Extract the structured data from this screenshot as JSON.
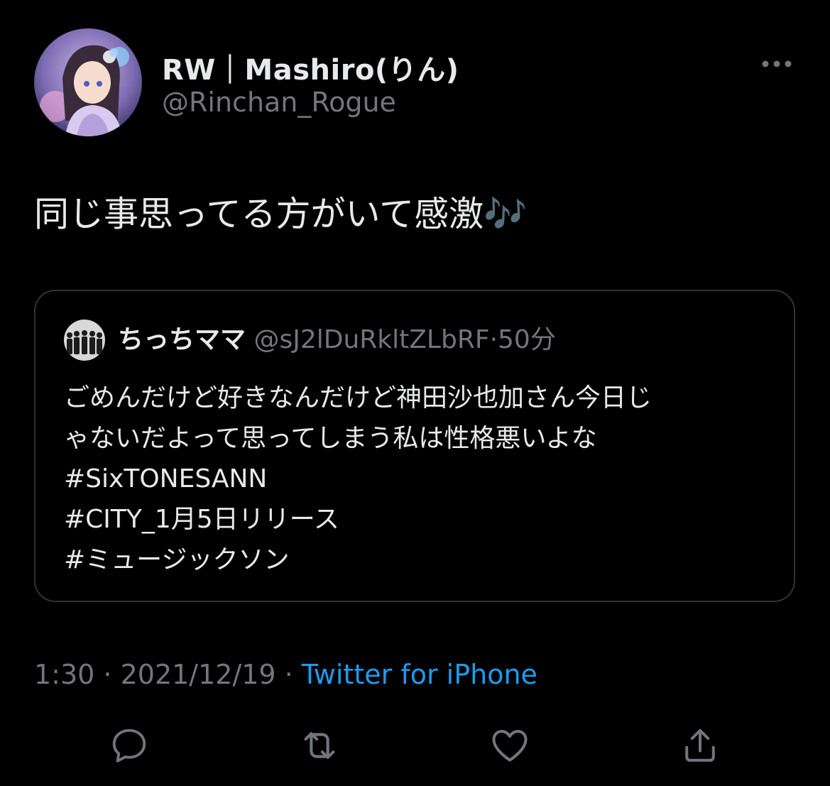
{
  "tweet": {
    "author": {
      "display_name": "RW｜Mashiro(りん)",
      "handle": "@Rinchan_Rogue",
      "avatar_icon": "anime-avatar-icon"
    },
    "text": "同じ事思ってる方がいて感激🎶",
    "quote": {
      "author_name": "ちっちママ",
      "author_handle": "@sJ2lDuRkltZLbRF",
      "separator": "·",
      "time": "50分",
      "avatar_icon": "group-photo-avatar-icon",
      "lines": [
        "ごめんだけど好きなんだけど神田沙也加さん今日じ",
        "ゃないだよって思ってしまう私は性格悪いよな",
        "#SixTONESANN",
        "#CITY_1月5日リリース",
        "#ミュージックソン"
      ]
    },
    "time": "1:30",
    "sep1": " · ",
    "date": "2021/12/19",
    "sep2": " · ",
    "source": "Twitter for iPhone"
  },
  "actions": {
    "reply_icon": "reply-icon",
    "retweet_icon": "retweet-icon",
    "like_icon": "heart-icon",
    "share_icon": "share-icon",
    "more_icon": "more-icon"
  },
  "colors": {
    "background": "#000000",
    "primary_text": "#e7e9ea",
    "secondary_text": "#71767b",
    "link": "#1d9bf0",
    "border": "#2f3336"
  }
}
